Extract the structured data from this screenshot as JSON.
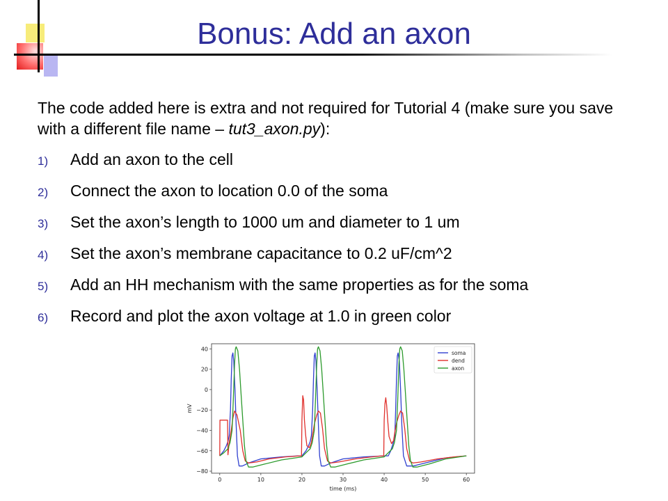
{
  "slide": {
    "title": "Bonus: Add an axon",
    "intro": {
      "part1": "The code added here is extra and not required for Tutorial 4 (make sure you save with a different file name – ",
      "filename": "tut3_axon.py",
      "part2": "):"
    },
    "steps": [
      {
        "num": "1)",
        "text": "Add an axon to the cell"
      },
      {
        "num": "2)",
        "text": "Connect the axon to location 0.0 of the soma"
      },
      {
        "num": "3)",
        "text": "Set the axon’s length to 1000 um and diameter to 1 um"
      },
      {
        "num": "4)",
        "text": "Set the axon’s membrane capacitance to 0.2 uF/cm^2"
      },
      {
        "num": "5)",
        "text": "Add an HH mechanism with the same properties as for the soma"
      },
      {
        "num": "6)",
        "text": "Record and plot the axon voltage at 1.0 in green color"
      }
    ]
  },
  "chart_data": {
    "type": "line",
    "xlabel": "time (ms)",
    "ylabel": "mV",
    "xlim": [
      -2,
      62
    ],
    "ylim": [
      -82,
      45
    ],
    "xticks": [
      0,
      10,
      20,
      30,
      40,
      50,
      60
    ],
    "yticks": [
      40,
      20,
      0,
      -20,
      -40,
      -60,
      -80
    ],
    "ytick_labels": [
      "40",
      "20",
      "0",
      "−20",
      "−40",
      "−60",
      "−80"
    ],
    "legend_position": "top-right",
    "series": [
      {
        "name": "soma",
        "color": "#2f3fcf",
        "x": [
          0,
          1,
          1.6,
          2,
          2.3,
          2.6,
          2.8,
          3.0,
          3.2,
          3.4,
          3.7,
          4.0,
          4.3,
          4.7,
          5.5,
          7,
          10,
          15,
          19,
          20,
          21,
          21.6,
          22,
          22.3,
          22.6,
          22.8,
          23.0,
          23.2,
          23.4,
          23.7,
          24.0,
          24.3,
          24.7,
          25.5,
          27,
          30,
          35,
          40,
          41,
          41.6,
          42,
          42.3,
          42.6,
          42.8,
          43.0,
          43.2,
          43.4,
          43.7,
          44.0,
          44.3,
          44.7,
          45.5,
          47,
          50,
          55,
          60
        ],
        "y": [
          -65,
          -60,
          -55,
          -51,
          -45,
          -20,
          10,
          33,
          36,
          28,
          0,
          -35,
          -65,
          -75,
          -75,
          -72,
          -68,
          -66,
          -65,
          -65,
          -60,
          -55,
          -51,
          -45,
          -20,
          10,
          33,
          36,
          28,
          0,
          -35,
          -65,
          -75,
          -75,
          -72,
          -68,
          -66,
          -65,
          -65,
          -60,
          -55,
          -51,
          -45,
          -20,
          10,
          33,
          36,
          28,
          0,
          -35,
          -65,
          -75,
          -75,
          -72,
          -67,
          -65
        ]
      },
      {
        "name": "dend",
        "color": "#e0302c",
        "x": [
          0,
          0.05,
          1.9,
          2.0,
          2.3,
          2.8,
          3.2,
          3.6,
          4.2,
          5.0,
          5.6,
          6.2,
          7,
          9,
          12,
          16,
          19.5,
          19.9,
          20.0,
          20.2,
          20.4,
          20.6,
          20.9,
          21.2,
          21.8,
          22.3,
          22.6,
          23.0,
          23.6,
          24.0,
          24.5,
          25.0,
          25.5,
          26.2,
          27,
          29,
          33,
          37,
          39.5,
          39.9,
          40.0,
          40.2,
          40.4,
          40.6,
          40.9,
          41.2,
          41.8,
          42.3,
          42.6,
          43.0,
          43.6,
          44.0,
          44.5,
          45.0,
          45.5,
          46.2,
          47,
          49,
          53,
          57,
          60
        ],
        "y": [
          -65,
          -30,
          -30,
          -64,
          -52,
          -40,
          -28,
          -21,
          -25,
          -40,
          -60,
          -70,
          -72,
          -71,
          -68,
          -66,
          -65,
          -65,
          -30,
          -6,
          -10,
          -30,
          -45,
          -55,
          -57,
          -52,
          -44,
          -34,
          -25,
          -21,
          -23,
          -38,
          -58,
          -70,
          -72,
          -71,
          -68,
          -66,
          -65,
          -65,
          -30,
          -14,
          -8,
          -15,
          -32,
          -46,
          -53,
          -50,
          -42,
          -33,
          -25,
          -21,
          -23,
          -38,
          -58,
          -70,
          -72,
          -71,
          -68,
          -66,
          -65
        ]
      },
      {
        "name": "axon",
        "color": "#2c9a2c",
        "x": [
          0,
          1,
          2,
          2.5,
          3.0,
          3.3,
          3.6,
          3.8,
          4.0,
          4.4,
          4.8,
          5.2,
          5.6,
          6.0,
          6.4,
          7.0,
          8,
          11,
          15,
          20,
          21,
          22,
          22.5,
          23.0,
          23.3,
          23.6,
          23.8,
          24.0,
          24.4,
          24.8,
          25.2,
          25.6,
          26.0,
          26.4,
          27.0,
          28,
          31,
          35,
          40,
          41,
          42,
          42.5,
          43.0,
          43.3,
          43.6,
          43.8,
          44.0,
          44.4,
          44.8,
          45.2,
          45.6,
          46.0,
          46.4,
          47.0,
          48,
          51,
          55,
          60
        ],
        "y": [
          -65,
          -62,
          -58,
          -52,
          -40,
          -10,
          25,
          40,
          42,
          38,
          20,
          -5,
          -30,
          -55,
          -70,
          -76,
          -76,
          -73,
          -69,
          -66,
          -62,
          -58,
          -52,
          -40,
          -10,
          25,
          40,
          42,
          38,
          20,
          -5,
          -30,
          -55,
          -70,
          -76,
          -76,
          -73,
          -69,
          -66,
          -62,
          -58,
          -52,
          -40,
          -10,
          25,
          40,
          42,
          38,
          20,
          -5,
          -30,
          -55,
          -70,
          -76,
          -76,
          -73,
          -68,
          -65
        ]
      }
    ]
  }
}
